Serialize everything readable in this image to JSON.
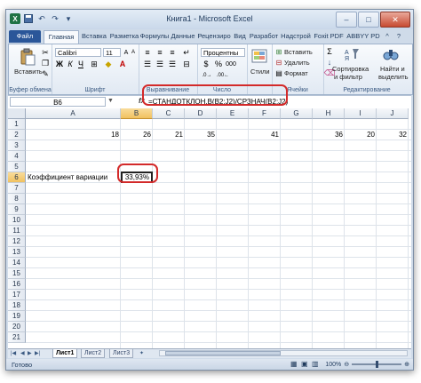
{
  "window": {
    "title": "Книга1 - Microsoft Excel",
    "app_icon": "X"
  },
  "tabs": [
    {
      "label": "Файл"
    },
    {
      "label": "Главная"
    },
    {
      "label": "Вставка"
    },
    {
      "label": "Разметка"
    },
    {
      "label": "Формулы"
    },
    {
      "label": "Данные"
    },
    {
      "label": "Рецензиро"
    },
    {
      "label": "Вид"
    },
    {
      "label": "Разработ"
    },
    {
      "label": "Надстрой"
    },
    {
      "label": "Foxit PDF"
    },
    {
      "label": "ABBYY PD"
    }
  ],
  "ribbon": {
    "clipboard": {
      "paste_label": "Вставить",
      "group_label": "Буфер обмена"
    },
    "font": {
      "font_name": "Calibri",
      "font_size": "11",
      "bold": "Ж",
      "italic": "К",
      "underline": "Ч",
      "group_label": "Шрифт"
    },
    "alignment": {
      "group_label": "Выравнивание"
    },
    "number": {
      "format": "Процентны",
      "group_label": "Число"
    },
    "styles": {
      "label": "Стили",
      "group_label": ""
    },
    "cells": {
      "insert": "Вставить",
      "delete": "Удалить",
      "format": "Формат",
      "group_label": "Ячейки"
    },
    "editing": {
      "sort": "Сортировка",
      "sort2": "и фильтр",
      "find": "Найти и",
      "find2": "выделить",
      "group_label": "Редактирование"
    }
  },
  "formula_bar": {
    "name_box": "B6",
    "fx": "fx",
    "formula": "=СТАНДОТКЛОН.В(B2:J2)/СРЗНАЧ(B2:J2)"
  },
  "columns": [
    "A",
    "B",
    "C",
    "D",
    "E",
    "F",
    "G",
    "H",
    "I",
    "J"
  ],
  "rows": [
    "1",
    "2",
    "3",
    "4",
    "5",
    "6",
    "7",
    "8",
    "9",
    "10",
    "11",
    "12",
    "13",
    "14",
    "15",
    "16",
    "17",
    "18",
    "19",
    "20",
    "21"
  ],
  "row2_values": [
    "18",
    "26",
    "21",
    "35",
    "",
    "41",
    "",
    "36",
    "20",
    "32"
  ],
  "a6_label": "Коэффициент вариации",
  "b6_value": "33,93%",
  "sheets": [
    "Лист1",
    "Лист2",
    "Лист3"
  ],
  "status": {
    "ready": "Готово",
    "zoom": "100%"
  }
}
